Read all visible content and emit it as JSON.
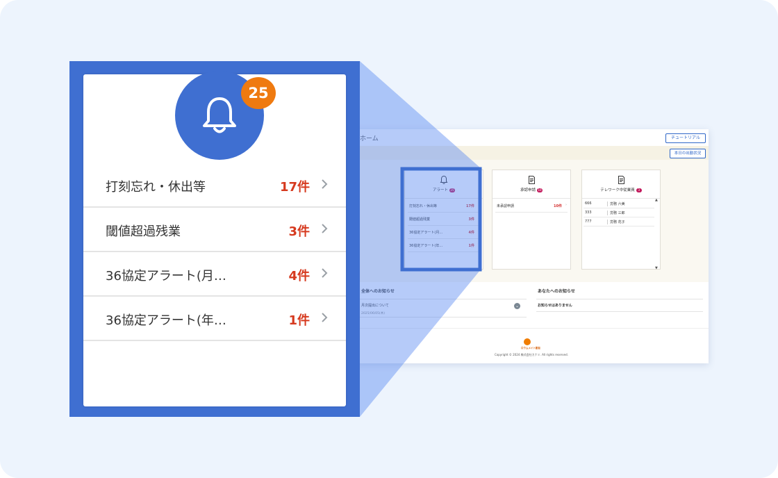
{
  "zoom": {
    "badge_count": "25",
    "alerts": [
      {
        "label": "打刻忘れ・休出等",
        "count": "17件"
      },
      {
        "label": "閾値超過残業",
        "count": "3件"
      },
      {
        "label": "36協定アラート(月…",
        "count": "4件"
      },
      {
        "label": "36協定アラート(年…",
        "count": "1件"
      }
    ]
  },
  "app": {
    "page_title": "ホーム",
    "tutorial_button": "チュートリアル",
    "attendance_button": "本日の出勤状況",
    "cards": {
      "alert": {
        "title": "アラート",
        "badge": "25",
        "rows": [
          {
            "label": "打刻忘れ・休出等",
            "count": "17件"
          },
          {
            "label": "閾値超過残業",
            "count": "3件"
          },
          {
            "label": "36協定アラート(月…",
            "count": "4件"
          },
          {
            "label": "36協定アラート(年…",
            "count": "1件"
          }
        ]
      },
      "approval": {
        "title": "承認申請",
        "badge": "10",
        "rows": [
          {
            "label": "未承認申請",
            "count": "10件"
          }
        ]
      },
      "telework": {
        "title": "テレワーク中従業員",
        "badge": "3",
        "rows": [
          {
            "id": "666",
            "name": "労務 六美"
          },
          {
            "id": "333",
            "name": "労務 三郎"
          },
          {
            "id": "777",
            "name": "労務 花子"
          }
        ]
      }
    },
    "notices": {
      "all_title": "全体へのお知らせ",
      "all_item_title": "月次提出について",
      "all_item_date": "2025/06/05(木)",
      "mine_title": "あなたへのお知らせ",
      "mine_empty": "お知らせはありません"
    },
    "footer": {
      "logo_text": "ロウムメイト勤怠",
      "copyright": "Copyright © 2024 株式会社カナミ. All rights reserved."
    }
  },
  "colors": {
    "accent_blue": "#3f6fd1",
    "badge_orange": "#ef7a10",
    "count_red": "#d63a1f",
    "background": "#edf4fd"
  },
  "icons": [
    "bell-icon",
    "chevron-right-icon",
    "document-icon",
    "chevron-down-icon"
  ]
}
